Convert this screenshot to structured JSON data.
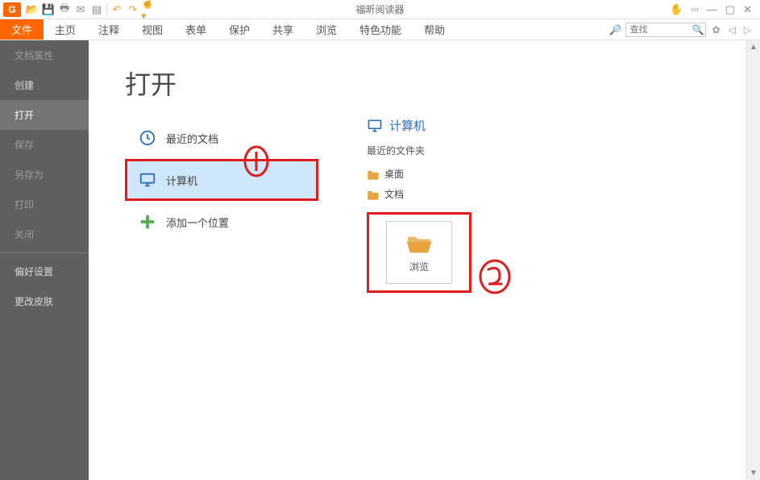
{
  "app_title": "福昕阅读器",
  "ribbon_tabs": {
    "file": "文件",
    "home": "主页",
    "comment": "注释",
    "view": "视图",
    "form": "表单",
    "protect": "保护",
    "share": "共享",
    "browse": "浏览",
    "feature": "特色功能",
    "help": "帮助"
  },
  "search": {
    "placeholder": "查找"
  },
  "sidebar": {
    "doc_props": "文档属性",
    "create": "创建",
    "open": "打开",
    "save": "保存",
    "save_as": "另存为",
    "print": "打印",
    "close": "关闭",
    "preferences": "偏好设置",
    "skin": "更改皮肤"
  },
  "main": {
    "title": "打开",
    "options": {
      "recent": "最近的文档",
      "computer": "计算机",
      "add_place": "添加一个位置"
    },
    "computer_header": "计算机",
    "recent_folders_label": "最近的文件夹",
    "folders": {
      "desktop": "桌面",
      "documents": "文档"
    },
    "browse": "浏览"
  },
  "annotations": {
    "one": "①",
    "two": "②"
  }
}
